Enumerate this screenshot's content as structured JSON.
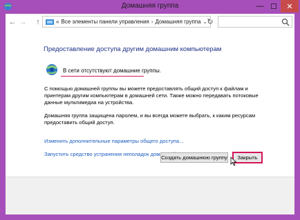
{
  "window": {
    "title": "Домашняя группа",
    "controls": {
      "minimize": "—",
      "maximize": "☐",
      "close": "✕"
    }
  },
  "navbar": {
    "back_icon": "arrow-left-icon",
    "forward_icon": "arrow-right-icon",
    "up_icon": "arrow-up-icon",
    "address": {
      "crumb_separator": "«",
      "crumbs": [
        "Все элементы панели управления",
        "Домашняя группа"
      ],
      "separator": "›",
      "dropdown": "⌄"
    },
    "refresh_icon": "refresh-icon",
    "search_placeholder": "",
    "search_icon": "search-icon"
  },
  "content": {
    "heading": "Предоставление доступа другим домашним компьютерам",
    "status": "В сети отсутствуют домашние группы.",
    "paragraph1": "С помощью домашней группы вы можете предоставлять общий доступ к файлам и принтерам другим компьютерам в домашней сети. Также можно передавать потоковые данные мультимедиа на устройства.",
    "paragraph2": "Домашняя группа защищена паролем, и вы всегда можете выбрать, к каким ресурсам предоставить общий доступ.",
    "link1": "Изменить дополнительные параметры общего доступа...",
    "link2": "Запустить средство устранения неполадок домашней группы"
  },
  "footer": {
    "create_button": "Создать домашнюю группу",
    "close_button": "Закрыть"
  },
  "colors": {
    "frame": "#a64fba",
    "heading": "#1e3287",
    "link": "#1a5cbf",
    "highlight": "#d4145a"
  }
}
